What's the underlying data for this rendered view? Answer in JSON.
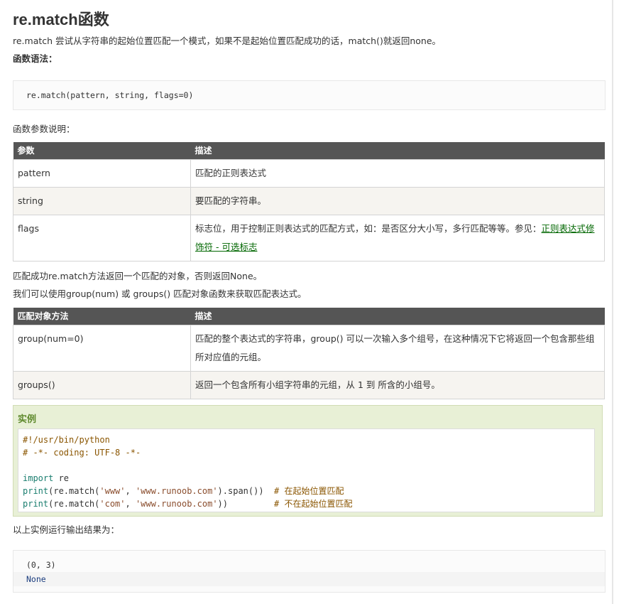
{
  "title": "re.match函数",
  "intro": "re.match 尝试从字符串的起始位置匹配一个模式，如果不是起始位置匹配成功的话，match()就返回none。",
  "syntax_label": "函数语法：",
  "syntax_code": "re.match(pattern, string, flags=0)",
  "params_label": "函数参数说明：",
  "params_table": {
    "headers": [
      "参数",
      "描述"
    ],
    "rows": [
      {
        "name": "pattern",
        "desc": "匹配的正则表达式"
      },
      {
        "name": "string",
        "desc": "要匹配的字符串。"
      },
      {
        "name": "flags",
        "desc": "标志位，用于控制正则表达式的匹配方式，如：是否区分大小写，多行匹配等等。参见：",
        "link": "正则表达式修饰符 - 可选标志"
      }
    ]
  },
  "after_params_1": "匹配成功re.match方法返回一个匹配的对象，否则返回None。",
  "after_params_2": "我们可以使用group(num) 或 groups() 匹配对象函数来获取匹配表达式。",
  "methods_table": {
    "headers": [
      "匹配对象方法",
      "描述"
    ],
    "rows": [
      {
        "name": "group(num=0)",
        "desc": "匹配的整个表达式的字符串，group() 可以一次输入多个组号，在这种情况下它将返回一个包含那些组所对应值的元组。"
      },
      {
        "name": "groups()",
        "desc": "返回一个包含所有小组字符串的元组，从 1 到 所含的小组号。"
      }
    ]
  },
  "example": {
    "title": "实例",
    "lines": {
      "l1": "#!/usr/bin/python",
      "l2": "# -*- coding: UTF-8 -*-",
      "l4_kw": "import",
      "l4_rest": " re",
      "l5_kw": "print",
      "l5_a": "(re.match(",
      "l5_s1": "'www'",
      "l5_b": ", ",
      "l5_s2": "'www.runoob.com'",
      "l5_c": ").span())  ",
      "l5_cm": "# 在起始位置匹配",
      "l6_kw": "print",
      "l6_a": "(re.match(",
      "l6_s1": "'com'",
      "l6_b": ", ",
      "l6_s2": "'www.runoob.com'",
      "l6_c": "))         ",
      "l6_cm": "# 不在起始位置匹配"
    }
  },
  "output_label": "以上实例运行输出结果为：",
  "output_lines": [
    "(0, 3)",
    "None"
  ]
}
